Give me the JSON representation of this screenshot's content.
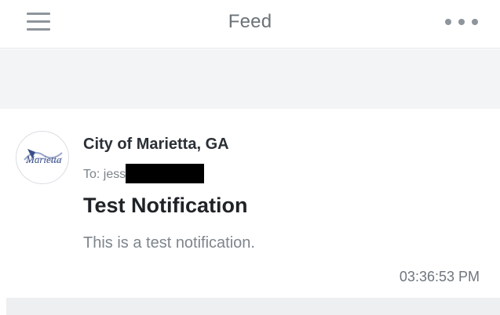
{
  "header": {
    "title": "Feed",
    "menu_icon": "hamburger-menu-icon",
    "more_icon": "more-options-icon"
  },
  "notification": {
    "sender": "City of Marietta, GA",
    "to_prefix": "To: jess",
    "subject": "Test Notification",
    "body": "This is a test notification.",
    "timestamp": "03:36:53 PM",
    "avatar_logo_text": "Marietta"
  },
  "colors": {
    "header_text": "#6b7278",
    "icon_gray": "#8e959c",
    "band_bg": "#f3f4f6",
    "logo_blue": "#3a4f8a"
  }
}
